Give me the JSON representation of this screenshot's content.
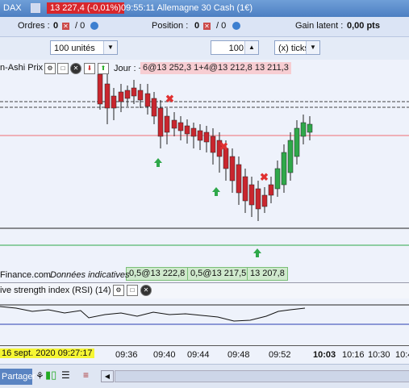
{
  "titlebar": {
    "symbol": "DAX",
    "price": "13 227,4 (-0,01%)",
    "info": "09:55:11 Allemagne 30 Cash (1€)"
  },
  "status": {
    "orders_label": "Ordres :",
    "orders_value": "0",
    "orders_sep": "/ 0",
    "position_label": "Position :",
    "position_value": "0",
    "position_sep": "/ 0",
    "gain_label": "Gain latent :",
    "gain_value": "0,00 pts"
  },
  "toolbar": {
    "qty": "100 unités",
    "ticks_value": "100",
    "ticks_unit": "(x) ticks"
  },
  "chart": {
    "indicator_label": "n-Ashi Prix",
    "period_label": "Jour : +",
    "pink_tag_text": "6@13 252,3 1+4@13 212,8 13 211,3",
    "watermark": "Finance.com",
    "watermark_note": "Données indicatives",
    "orders": [
      "0,5@13 222,8",
      "0,5@13 217,5",
      "13 207,8"
    ]
  },
  "rsi": {
    "label": "ive strength index (RSI) (14)"
  },
  "timeaxis": {
    "date": "16 sept. 2020 09:27:17",
    "ticks": [
      "09:36",
      "09:40",
      "09:44",
      "09:48",
      "09:52",
      "10:03",
      "10:16",
      "10:30",
      "10:4"
    ]
  },
  "bottombar": {
    "share": "Partager"
  },
  "colors": {
    "up": "#2fa84a",
    "down": "#c9262e",
    "sell_marker": "#e03030",
    "buy_marker": "#2fa84a"
  }
}
